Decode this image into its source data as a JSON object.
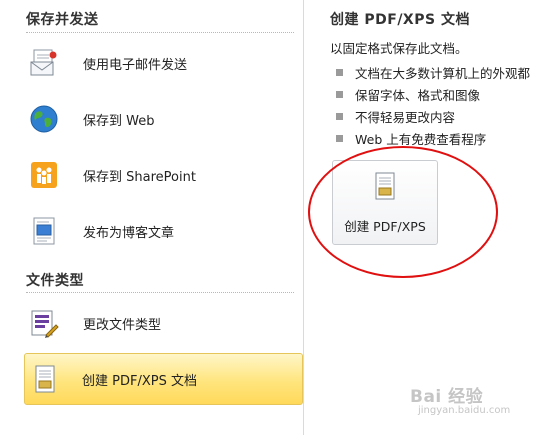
{
  "left": {
    "section_send": "保存并发送",
    "send_items": [
      {
        "label": "使用电子邮件发送",
        "icon": "email-icon"
      },
      {
        "label": "保存到 Web",
        "icon": "globe-icon"
      },
      {
        "label": "保存到 SharePoint",
        "icon": "sharepoint-icon"
      },
      {
        "label": "发布为博客文章",
        "icon": "blog-icon"
      }
    ],
    "section_filetype": "文件类型",
    "filetype_items": [
      {
        "label": "更改文件类型",
        "icon": "change-filetype-icon"
      },
      {
        "label": "创建 PDF/XPS 文档",
        "icon": "pdf-document-icon",
        "selected": true
      }
    ]
  },
  "right": {
    "title": "创建 PDF/XPS 文档",
    "description": "以固定格式保存此文档。",
    "bullets": [
      "文档在大多数计算机上的外观都",
      "保留字体、格式和图像",
      "不得轻易更改内容",
      "Web 上有免费查看程序"
    ],
    "button_label": "创建 PDF/XPS"
  },
  "watermark": {
    "text": "Bai 经验",
    "sub": "jingyan.baidu.com"
  },
  "colors": {
    "selected_fill": "#ffe57e",
    "annotation": "#e01010"
  }
}
